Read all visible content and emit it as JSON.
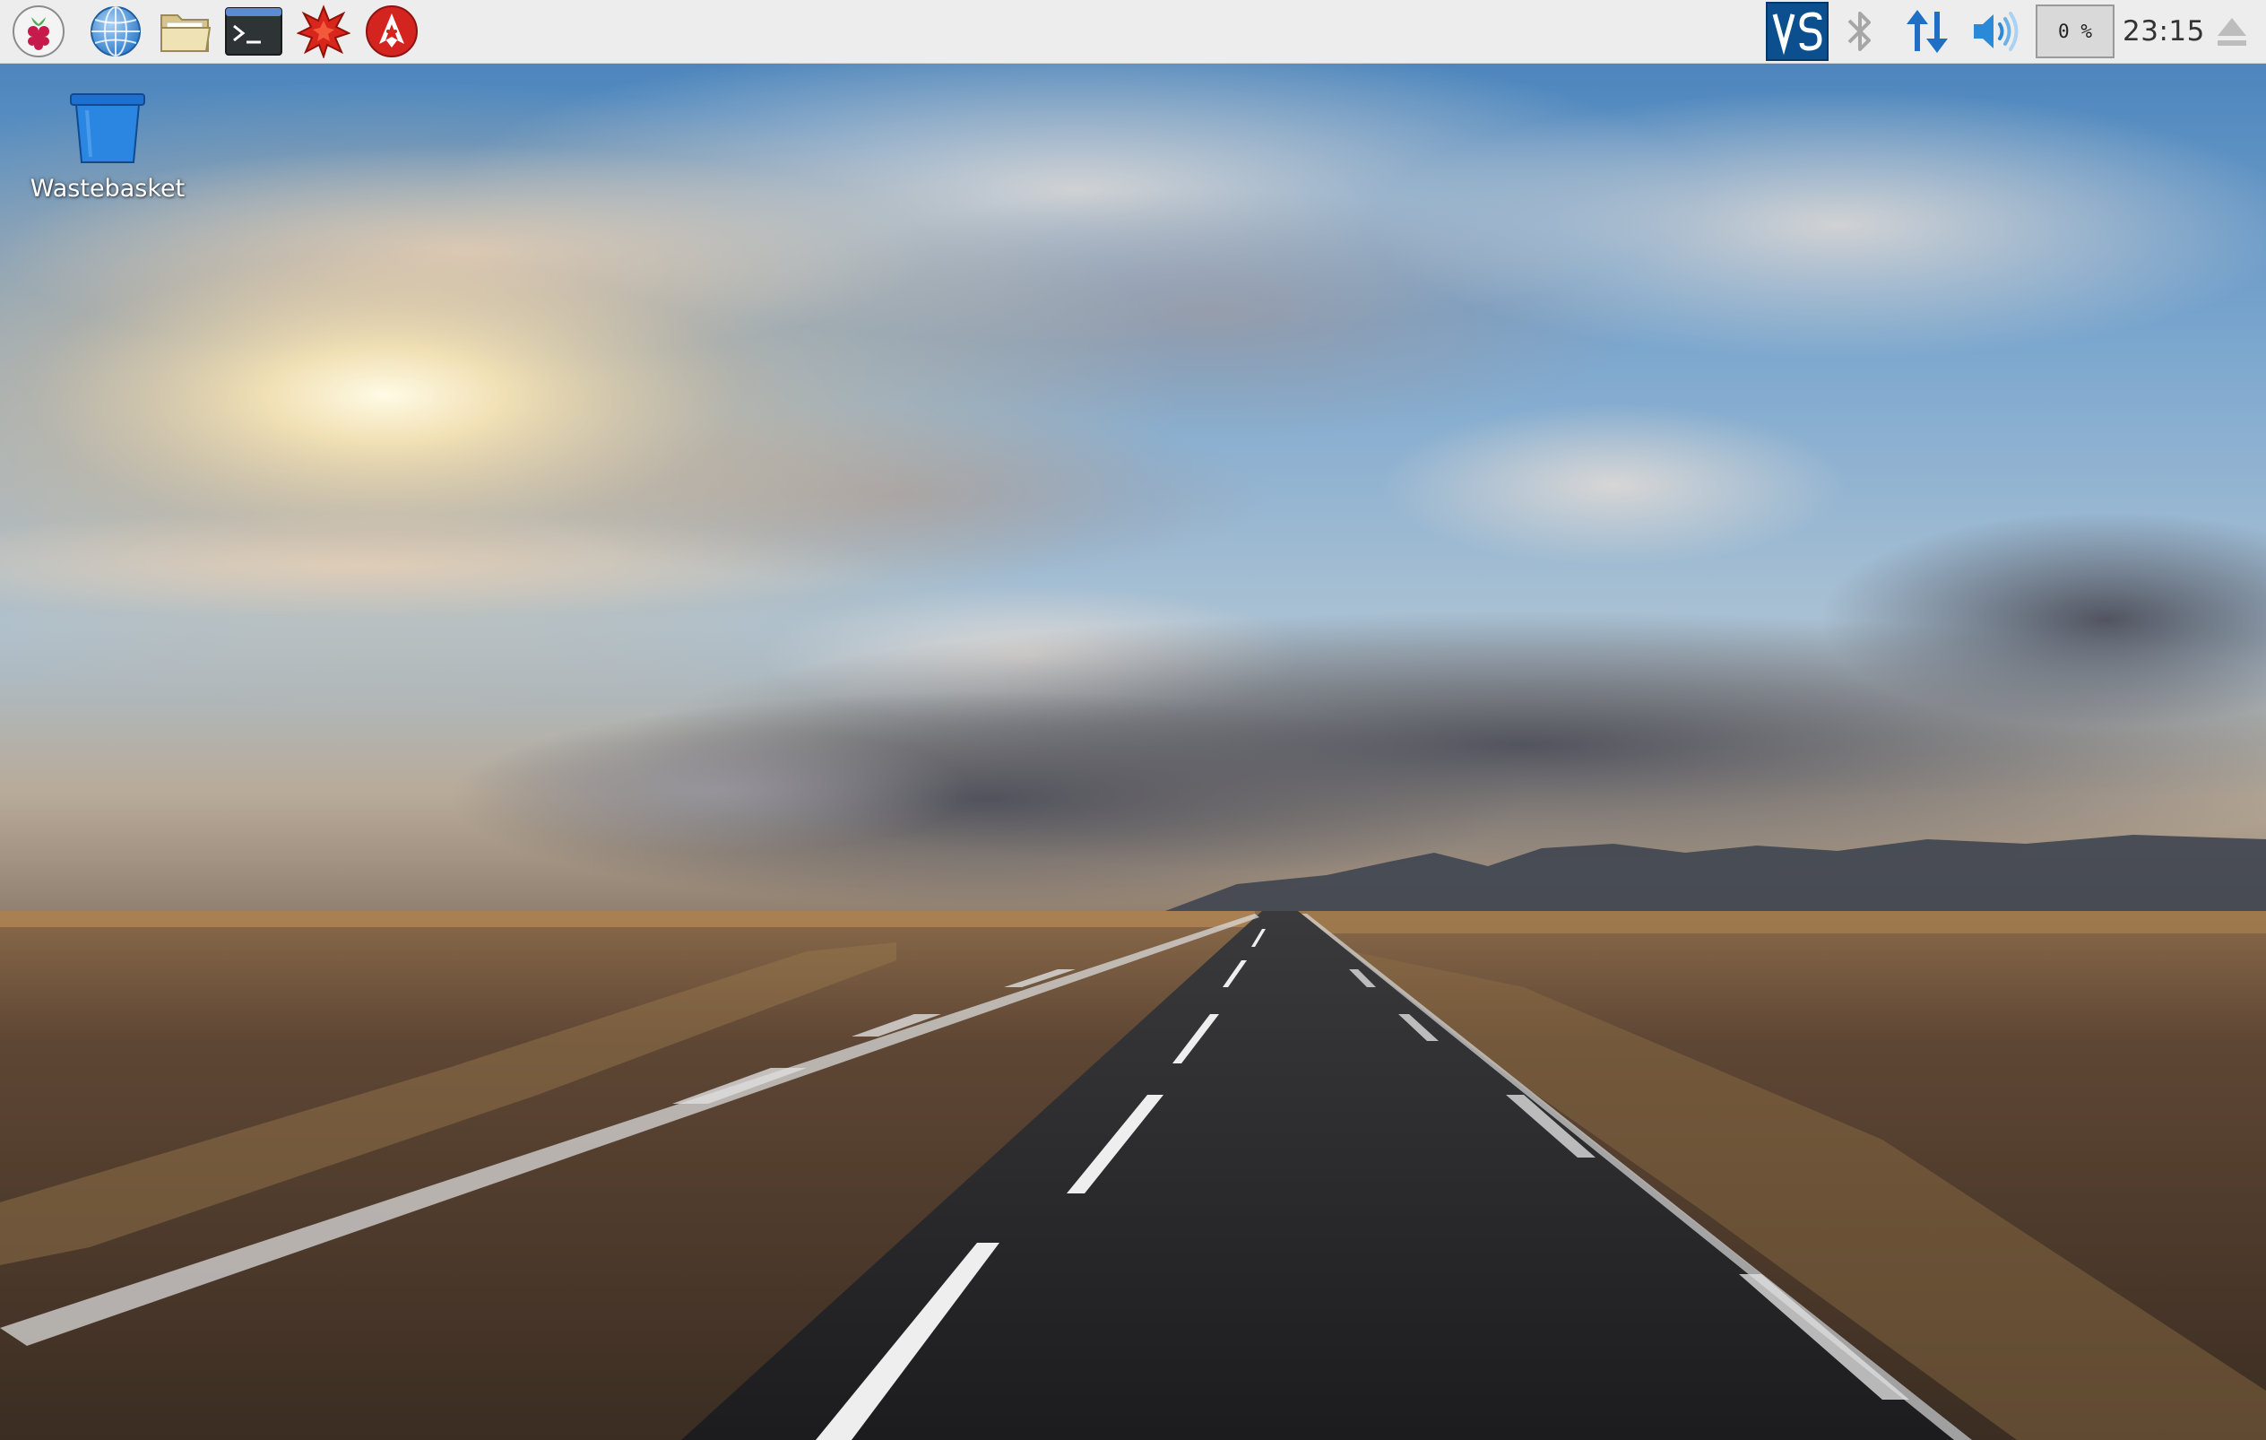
{
  "taskbar": {
    "launchers": [
      {
        "name": "Menu",
        "icon": "raspberry-icon"
      },
      {
        "name": "Web Browser",
        "icon": "globe-icon"
      },
      {
        "name": "File Manager",
        "icon": "folder-icon"
      },
      {
        "name": "Terminal",
        "icon": "terminal-icon"
      },
      {
        "name": "Mathematica",
        "icon": "mathematica-icon"
      },
      {
        "name": "Wolfram",
        "icon": "wolfram-icon"
      }
    ],
    "tray": {
      "vnc_icon": "vnc-icon",
      "bluetooth_icon": "bluetooth-icon",
      "network_icon": "network-arrows-icon",
      "volume_icon": "volume-icon",
      "cpu_usage": "0 %",
      "cpu_usage_fraction": 0.0,
      "clock": "23:15",
      "eject_icon": "eject-icon"
    },
    "colors": {
      "background": "#ededed",
      "accent_blue": "#1f6fc6",
      "vnc_bg": "#0b4f8f"
    }
  },
  "desktop": {
    "icons": [
      {
        "label": "Wastebasket",
        "icon": "wastebasket-icon"
      }
    ],
    "wallpaper": "road-at-sunset"
  }
}
